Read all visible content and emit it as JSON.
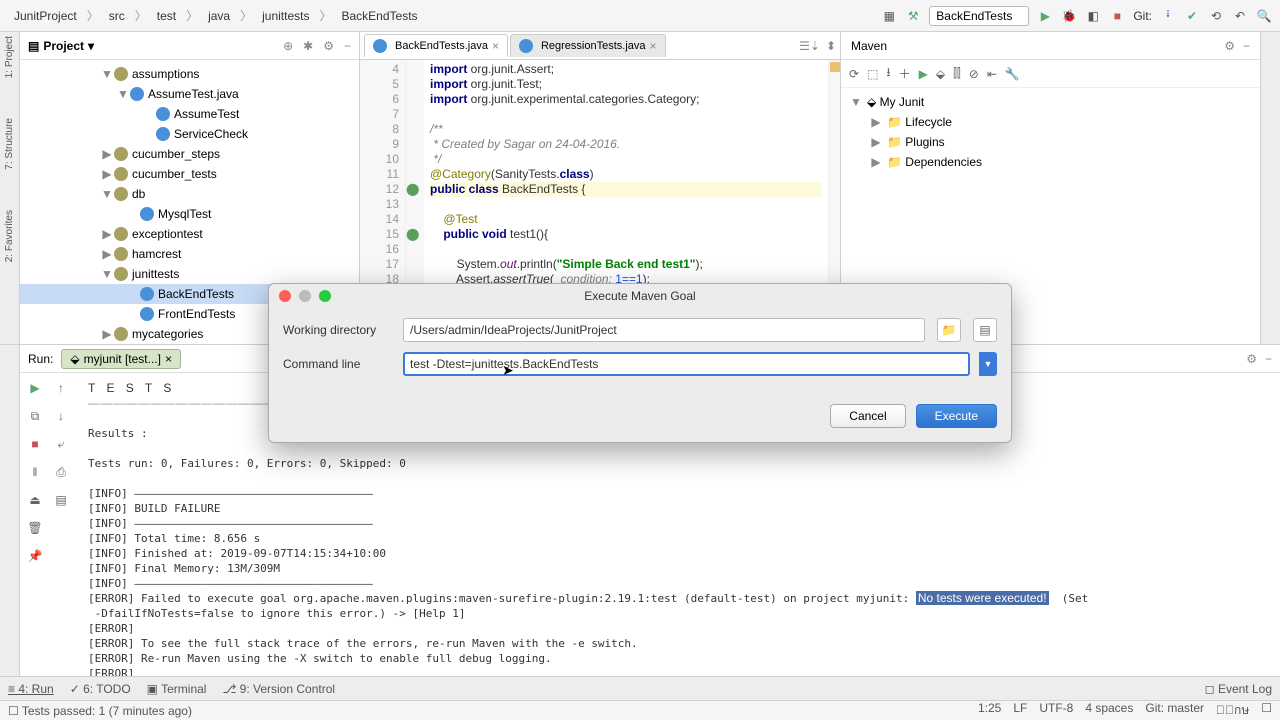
{
  "breadcrumb": [
    "JunitProject",
    "src",
    "test",
    "java",
    "junittests",
    "BackEndTests"
  ],
  "topbar": {
    "run_config": "BackEndTests",
    "git_label": "Git:"
  },
  "left_tabs": [
    "1: Project",
    "7: Structure",
    "2: Favorites"
  ],
  "project": {
    "title": "Project",
    "items": [
      {
        "indent": 80,
        "chev": "▼",
        "icon": "pkg",
        "label": "assumptions"
      },
      {
        "indent": 96,
        "chev": "▼",
        "icon": "class",
        "label": "AssumeTest.java"
      },
      {
        "indent": 122,
        "chev": "",
        "icon": "class",
        "label": "AssumeTest"
      },
      {
        "indent": 122,
        "chev": "",
        "icon": "class",
        "label": "ServiceCheck"
      },
      {
        "indent": 80,
        "chev": "▶",
        "icon": "pkg",
        "label": "cucumber_steps"
      },
      {
        "indent": 80,
        "chev": "▶",
        "icon": "pkg",
        "label": "cucumber_tests"
      },
      {
        "indent": 80,
        "chev": "▼",
        "icon": "pkg",
        "label": "db"
      },
      {
        "indent": 106,
        "chev": "",
        "icon": "class",
        "label": "MysqlTest"
      },
      {
        "indent": 80,
        "chev": "▶",
        "icon": "pkg",
        "label": "exceptiontest"
      },
      {
        "indent": 80,
        "chev": "▶",
        "icon": "pkg",
        "label": "hamcrest"
      },
      {
        "indent": 80,
        "chev": "▼",
        "icon": "pkg",
        "label": "junittests"
      },
      {
        "indent": 106,
        "chev": "",
        "icon": "class",
        "label": "BackEndTests",
        "sel": true
      },
      {
        "indent": 106,
        "chev": "",
        "icon": "class",
        "label": "FrontEndTests"
      },
      {
        "indent": 80,
        "chev": "▶",
        "icon": "pkg",
        "label": "mycategories"
      }
    ]
  },
  "editor": {
    "tabs": [
      {
        "name": "BackEndTests.java",
        "active": true
      },
      {
        "name": "RegressionTests.java",
        "active": false
      }
    ],
    "first_line": 4,
    "lines": [
      {
        "html": "<span class='kw'>import</span> org.junit.Assert;"
      },
      {
        "html": "<span class='kw'>import</span> org.junit.Test;"
      },
      {
        "html": "<span class='kw'>import</span> org.junit.experimental.categories.<span class='cls'>Category</span>;"
      },
      {
        "html": ""
      },
      {
        "html": "<span class='comm'>/**</span>"
      },
      {
        "html": "<span class='comm'> * Created by Sagar on 24-04-2016.</span>"
      },
      {
        "html": "<span class='comm'> */</span>"
      },
      {
        "html": "<span class='ann'>@Category</span>(SanityTests.<span class='kw'>class</span>)"
      },
      {
        "html": "<span class='kw'>public class</span> <span class='cls'>BackEndTests</span> {",
        "hl": true,
        "mark": "⬤"
      },
      {
        "html": ""
      },
      {
        "html": "    <span class='ann'>@Test</span>"
      },
      {
        "html": "    <span class='kw'>public void</span> test1(){",
        "mark": "⬤"
      },
      {
        "html": ""
      },
      {
        "html": "        System.<span style='color:#660e7a;font-style:italic'>out</span>.println(<span class='str'>\"Simple Back end test1\"</span>);"
      },
      {
        "html": "        Assert.<span style='font-style:italic'>assertTrue</span>(  <span class='comm'>condition:</span> <span style='color:#1750eb'>1==1</span>);"
      }
    ]
  },
  "maven": {
    "title": "Maven",
    "root": "My Junit",
    "children": [
      "Lifecycle",
      "Plugins",
      "Dependencies"
    ]
  },
  "run": {
    "label": "Run:",
    "tab": "myjunit [test...]",
    "tests_title": "T E S T S",
    "results_label": "Results :",
    "summary": "Tests run: 0, Failures: 0, Errors: 0, Skipped: 0",
    "info_lines": [
      "[INFO] ————————————————————————————————————",
      "[INFO] BUILD FAILURE",
      "[INFO] ————————————————————————————————————",
      "[INFO] Total time: 8.656 s",
      "[INFO] Finished at: 2019-09-07T14:15:34+10:00",
      "[INFO] Final Memory: 13M/309M",
      "[INFO] ————————————————————————————————————"
    ],
    "error_pre": "[ERROR] Failed to execute goal org.apache.maven.plugins:maven-surefire-plugin:2.19.1:test (default-test) on project myjunit: ",
    "error_hilite": "No tests were executed!",
    "error_post": "  (Set",
    "error_tail": [
      " -DfailIfNoTests=false to ignore this error.) -> [Help 1]",
      "[ERROR]",
      "[ERROR] To see the full stack trace of the errors, re-run Maven with the -e switch.",
      "[ERROR] Re-run Maven using the -X switch to enable full debug logging.",
      "[ERROR]"
    ]
  },
  "bottom_tabs": [
    "≡ 4: Run",
    "✓ 6: TODO",
    "▣ Terminal",
    "⎇ 9: Version Control"
  ],
  "bottom_right": "◻ Event Log",
  "status": {
    "left": "☐  Tests passed: 1 (7 minutes ago)",
    "right": [
      "1:25",
      "LF",
      "UTF-8",
      "4 spaces",
      "Git: master",
      "�ักษ",
      "☐"
    ]
  },
  "dialog": {
    "title": "Execute Maven Goal",
    "wd_label": "Working directory",
    "wd_value": "/Users/admin/IdeaProjects/JunitProject",
    "cmd_label": "Command line",
    "cmd_value": "test -Dtest=junittests.BackEndTests",
    "cancel": "Cancel",
    "execute": "Execute"
  }
}
